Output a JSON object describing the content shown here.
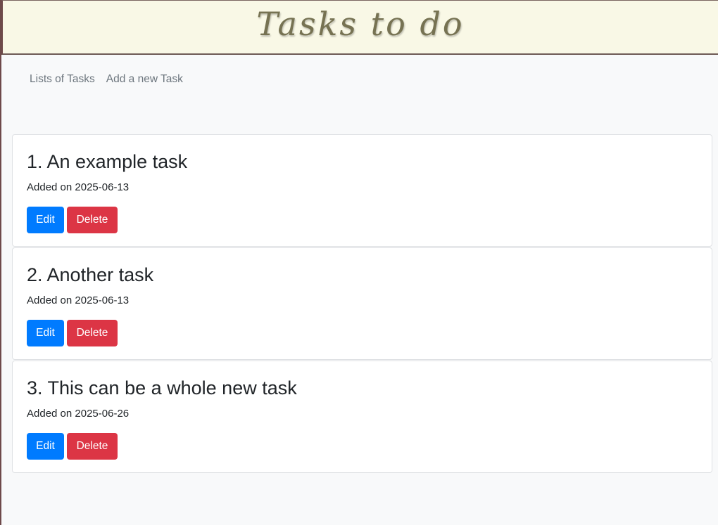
{
  "header": {
    "title": "Tasks to do"
  },
  "nav": {
    "items": [
      {
        "label": "Lists of Tasks"
      },
      {
        "label": "Add a new Task"
      }
    ]
  },
  "tasks": [
    {
      "title": "1. An example task",
      "date": "Added on 2025-06-13",
      "edit_label": "Edit",
      "delete_label": "Delete"
    },
    {
      "title": "2. Another task",
      "date": "Added on 2025-06-13",
      "edit_label": "Edit",
      "delete_label": "Delete"
    },
    {
      "title": "3. This can be a whole new task",
      "date": "Added on 2025-06-26",
      "edit_label": "Edit",
      "delete_label": "Delete"
    }
  ],
  "colors": {
    "header_bg": "#f9f8e6",
    "header_text": "#767252",
    "edit_button": "#007bff",
    "delete_button": "#dc3545",
    "page_bg": "#f8f9fa"
  }
}
